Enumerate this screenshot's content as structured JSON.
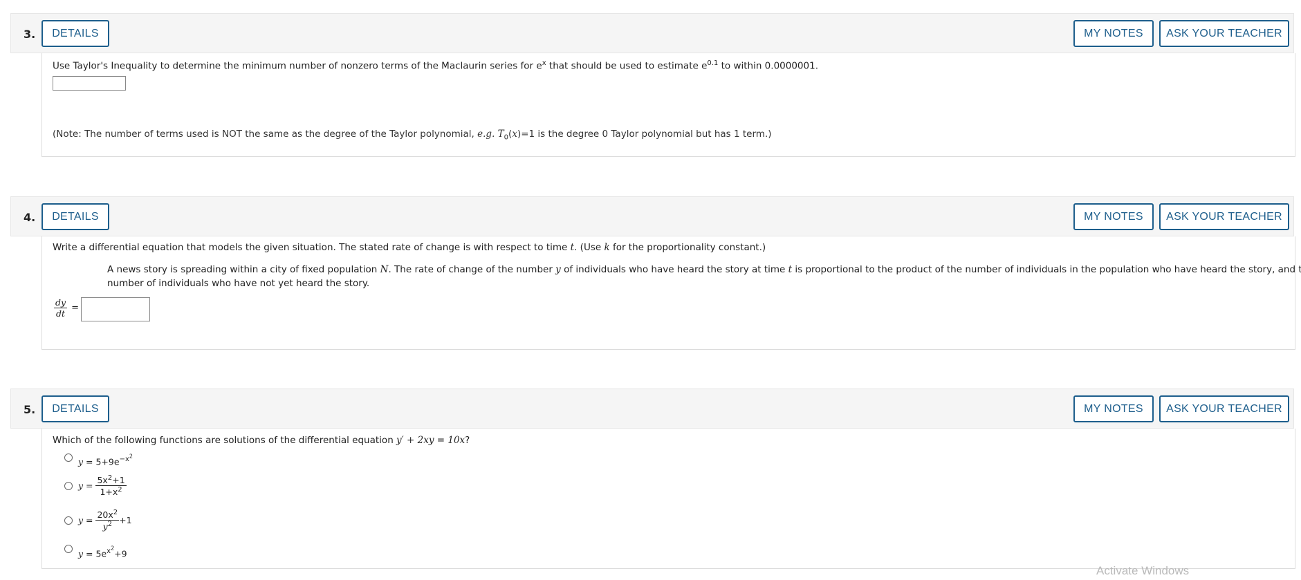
{
  "buttons": {
    "details": "DETAILS",
    "my_notes": "MY NOTES",
    "ask_teacher": "ASK YOUR TEACHER"
  },
  "q3": {
    "number": "3.",
    "prompt_a": "Use Taylor's Inequality to determine the minimum number of nonzero terms of the Maclaurin series for e",
    "prompt_sup_x": "x",
    "prompt_b": " that should be used to estimate e",
    "prompt_sup_val": "0.1",
    "prompt_c": " to within 0.0000001.",
    "answer_value": "",
    "note_a": "(Note: The number of terms used is NOT the same as the degree of the Taylor polynomial, ",
    "note_eg": "e.g.",
    "note_b": " ",
    "note_T": "T",
    "note_sub0": "0",
    "note_c": "(",
    "note_x": "x",
    "note_d": ")=1 is the degree 0 Taylor polynomial but has 1 term.)"
  },
  "q4": {
    "number": "4.",
    "prompt_a": "Write a differential equation that models the given situation. The stated rate of change is with respect to time ",
    "prompt_t": "t",
    "prompt_b": ". (Use ",
    "prompt_k": "k",
    "prompt_c": " for the proportionality constant.)",
    "story_line1_a": "A news story is spreading within a city of fixed population ",
    "story_N": "N",
    "story_line1_b": ". The rate of change of the number ",
    "story_y": "y",
    "story_line1_c": " of individuals who have heard the story at time ",
    "story_t": "t",
    "story_line1_d": " is proportional to the product of the number of individuals in the population who have heard the story, and the",
    "story_line2": "number of individuals who have not yet heard the story.",
    "frac_num": "dy",
    "frac_den": "dt",
    "equals": "=",
    "answer_value": ""
  },
  "q5": {
    "number": "5.",
    "prompt_a": "Which of the following functions are solutions of the differential equation ",
    "prompt_eq": "y′ + 2xy = 10x",
    "prompt_b": "?",
    "options": [
      {
        "lhs": "y",
        "eq": " = 5+9e",
        "sup": "−x",
        "supsup": "2"
      },
      {
        "lhs": "y",
        "eq": " = ",
        "num": "5x",
        "num_sup": "2",
        "num_rest": "+1",
        "den": "1+x",
        "den_sup": "2"
      },
      {
        "lhs": "y",
        "eq": " = ",
        "num": "20x",
        "num_sup": "2",
        "den": "y",
        "den_sup": "2",
        "tail": "+1"
      },
      {
        "lhs": "y",
        "eq": " = 5e",
        "sup": "x",
        "supsup": "2",
        "tail": "+9"
      }
    ]
  },
  "watermark": "Activate Windows"
}
